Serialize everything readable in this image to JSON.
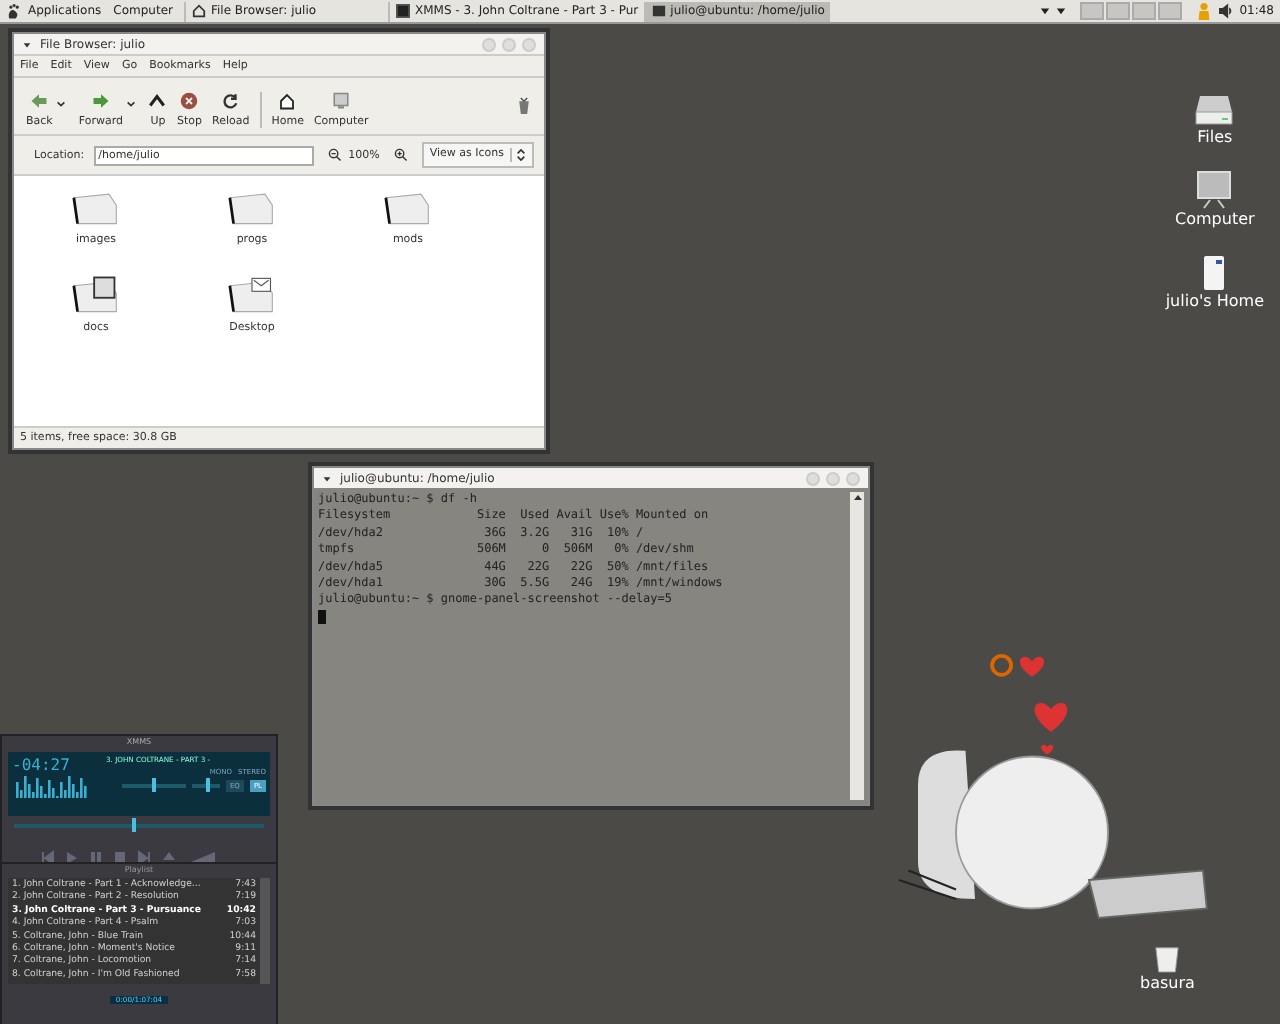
{
  "top_panel": {
    "menus": [
      "Applications",
      "Computer"
    ],
    "tasks": [
      {
        "label": "File Browser: julio",
        "kind": "folder",
        "selected": false
      },
      {
        "label": "XMMS - 3. John Coltrane - Part 3 - Pur",
        "kind": "xmms",
        "selected": false
      },
      {
        "label": "julio@ubuntu: /home/julio",
        "kind": "terminal",
        "selected": true
      }
    ],
    "clock": "01:48"
  },
  "file_browser": {
    "title": "File Browser: julio",
    "menu": [
      "File",
      "Edit",
      "View",
      "Go",
      "Bookmarks",
      "Help"
    ],
    "toolbar": [
      {
        "label": "Back",
        "kind": "back"
      },
      {
        "label": "Forward",
        "kind": "forward"
      },
      {
        "label": "Up",
        "kind": "up"
      },
      {
        "label": "Stop",
        "kind": "stop"
      },
      {
        "label": "Reload",
        "kind": "reload"
      },
      {
        "label": "Home",
        "kind": "home"
      },
      {
        "label": "Computer",
        "kind": "computer"
      }
    ],
    "location_label": "Location:",
    "location": "/home/julio",
    "zoom": "100%",
    "view_mode": "View as Icons",
    "items": [
      {
        "label": "images",
        "kind": "folder"
      },
      {
        "label": "progs",
        "kind": "folder"
      },
      {
        "label": "mods",
        "kind": "folder"
      },
      {
        "label": "docs",
        "kind": "docs"
      },
      {
        "label": "Desktop",
        "kind": "desktop"
      }
    ],
    "status": "5 items, free space: 30.8 GB"
  },
  "terminal": {
    "title": "julio@ubuntu: /home/julio",
    "lines": [
      "julio@ubuntu:~ $ df -h",
      "Filesystem            Size  Used Avail Use% Mounted on",
      "/dev/hda2              36G  3.2G   31G  10% /",
      "tmpfs                 506M     0  506M   0% /dev/shm",
      "/dev/hda5              44G   22G   22G  50% /mnt/files",
      "/dev/hda1              30G  5.5G   24G  19% /mnt/windows",
      "julio@ubuntu:~ $ gnome-panel-screenshot --delay=5"
    ]
  },
  "xmms": {
    "title": "XMMS",
    "time": "-04:27",
    "marquee": "3. JOHN COLTRANE - PART 3 -",
    "mono": "MONO",
    "stereo": "STEREO",
    "eq": {
      "label": "EQ",
      "on": false
    },
    "pl": {
      "label": "PL",
      "on": true
    },
    "volume": {
      "level": 0.5
    },
    "balance": {
      "level": 0.6
    },
    "seek": {
      "level": 0.48
    },
    "playlist_title": "Playlist",
    "playlist": [
      {
        "title": "1. John Coltrane - Part 1 - Acknowledge...",
        "time": "7:43",
        "selected": false
      },
      {
        "title": "2. John Coltrane - Part 2 - Resolution",
        "time": "7:19",
        "selected": false
      },
      {
        "title": "3. John Coltrane - Part 3 - Pursuance",
        "time": "10:42",
        "selected": true
      },
      {
        "title": "4. John Coltrane - Part 4 - Psalm",
        "time": "7:03",
        "selected": false
      },
      {
        "title": "5. Coltrane, John - Blue Train",
        "time": "10:44",
        "selected": false
      },
      {
        "title": "6. Coltrane, John - Moment's Notice",
        "time": "9:11",
        "selected": false
      },
      {
        "title": "7. Coltrane, John - Locomotion",
        "time": "7:14",
        "selected": false
      },
      {
        "title": "8. Coltrane, John - I'm Old Fashioned",
        "time": "7:58",
        "selected": false
      }
    ],
    "playlist_time": "0:00/1:07:04"
  },
  "desktop_icons": [
    {
      "label": "Files",
      "kind": "drive"
    },
    {
      "label": "Computer",
      "kind": "computer"
    },
    {
      "label": "julio's Home",
      "kind": "home"
    }
  ],
  "trash": {
    "label": "basura"
  }
}
